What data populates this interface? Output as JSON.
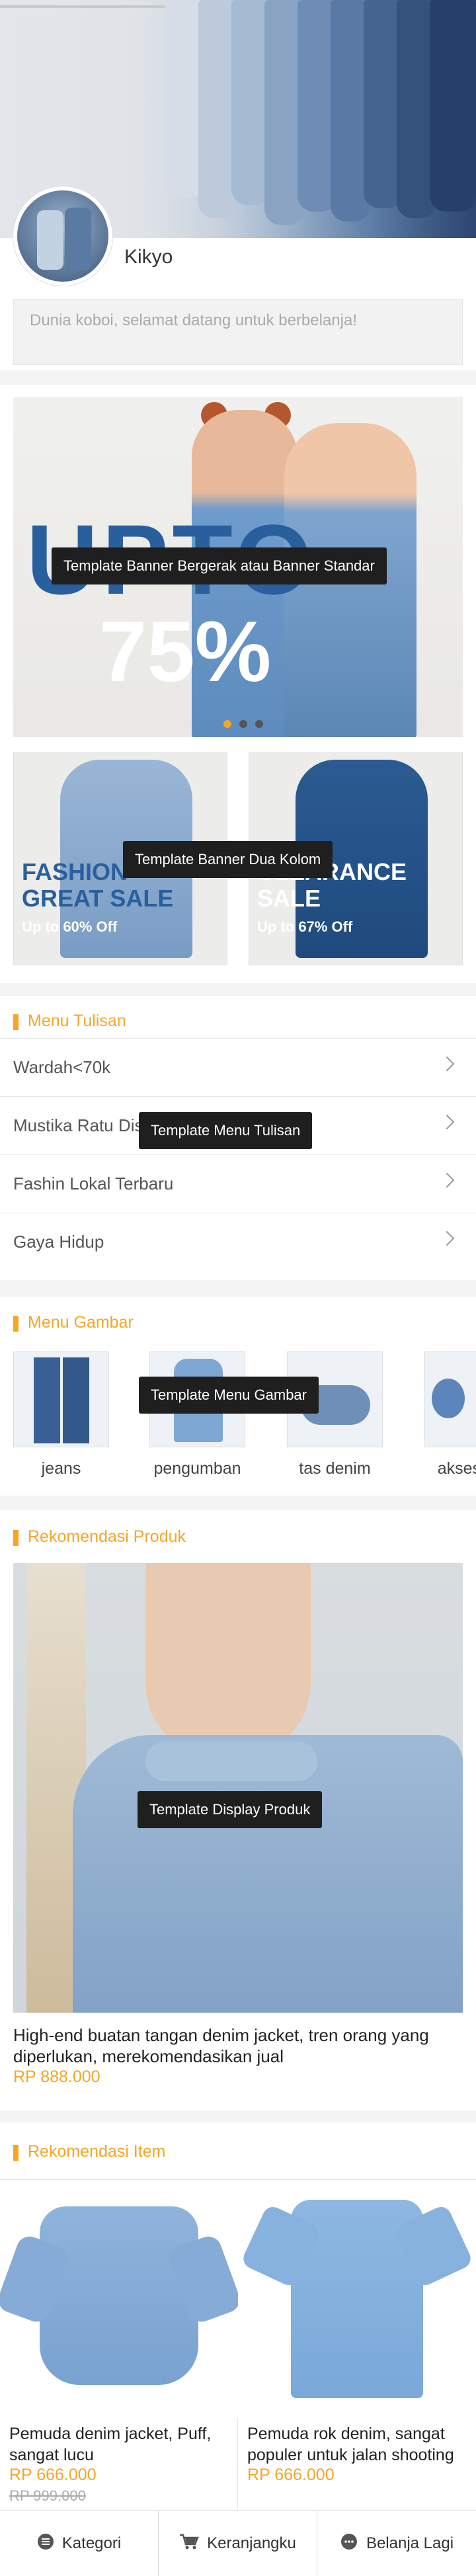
{
  "header": {
    "shop_name": "Kikyo",
    "welcome_text": "Dunia koboi, selamat datang untuk berbelanja!"
  },
  "carousel": {
    "tooltip": "Template Banner Bergerak atau Banner Standar",
    "headline": "UPTO",
    "discount": "75%",
    "slide_count": 3,
    "active_slide": 1
  },
  "two_column": {
    "tooltip": "Template Banner Dua Kolom",
    "left": {
      "title_line1": "FASHION",
      "title_line2": "GREAT SALE",
      "subtitle": "Up to 60% Off"
    },
    "right": {
      "title_line1": "CLEARANCE",
      "title_line2": "SALE",
      "subtitle": "Up to 67% Off"
    }
  },
  "text_menu": {
    "title": "Menu Tulisan",
    "tooltip": "Template Menu Tulisan",
    "items": [
      "Wardah<70k",
      "Mustika Ratu Diskon",
      "Fashin Lokal Terbaru",
      "Gaya Hidup"
    ]
  },
  "image_menu": {
    "title": "Menu Gambar",
    "tooltip": "Template Menu Gambar",
    "items": [
      "jeans",
      "pengumban",
      "tas denim",
      "aksesoris"
    ]
  },
  "product_rec": {
    "title": "Rekomendasi Produk",
    "tooltip": "Template Display Produk",
    "description": "High-end buatan tangan denim jacket, tren orang yang diperlukan, merekomendasikan jual",
    "price": "RP 888.000"
  },
  "item_rec": {
    "title": "Rekomendasi Item",
    "items": [
      {
        "description": "Pemuda denim jacket, Puff, sangat lucu",
        "price": "RP 666.000",
        "old_price": "RP 999.000"
      },
      {
        "description": "Pemuda rok denim, sangat populer untuk jalan shooting",
        "price": "RP 666.000",
        "old_price": ""
      }
    ]
  },
  "tabbar": {
    "items": [
      {
        "label": "Kategori",
        "icon": "list-icon"
      },
      {
        "label": "Keranjangku",
        "icon": "cart-icon"
      },
      {
        "label": "Belanja Lagi",
        "icon": "chat-icon"
      }
    ]
  },
  "colors": {
    "accent": "#f5a623",
    "tooltip_bg": "#1f1f1f",
    "denim": "#2a5f9e"
  }
}
